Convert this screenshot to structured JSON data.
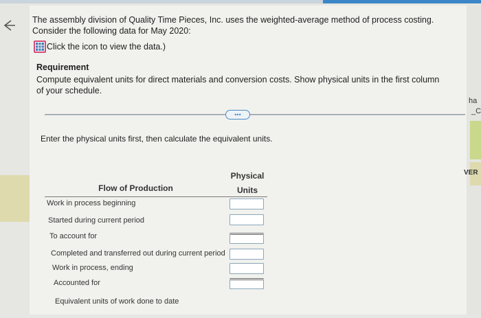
{
  "intro": {
    "text": "The assembly division of Quality Time Pieces, Inc. uses the weighted-average method of process costing. Consider the following data for May 2020:",
    "data_link_label": "Click the icon to view the data.)",
    "data_link_icon": "table-grid-icon"
  },
  "requirement": {
    "title": "Requirement",
    "text": "Compute equivalent units for direct materials and conversion costs. Show physical units in the first column of your schedule."
  },
  "more_button_label": "•••",
  "instruction": "Enter the physical units first, then calculate the equivalent units.",
  "table": {
    "col_flow": "Flow of Production",
    "col_physical_1": "Physical",
    "col_physical_2": "Units",
    "rows": [
      {
        "label": "Work in process beginning",
        "value": ""
      },
      {
        "label": "Started during current period",
        "value": ""
      },
      {
        "label": "To account for",
        "value": ""
      },
      {
        "label": "Completed and transferred out during current period",
        "value": ""
      },
      {
        "label": "Work in process, ending",
        "value": ""
      },
      {
        "label": "Accounted for",
        "value": ""
      },
      {
        "label": "Equivalent units of work done to date",
        "value": ""
      }
    ]
  },
  "side_tabs": {
    "a": "ha",
    "b": "_C",
    "ver": "VER"
  },
  "colors": {
    "accent_blue": "#3b86c6",
    "icon_border": "#d24b78",
    "input_border": "#8aa6b8"
  }
}
